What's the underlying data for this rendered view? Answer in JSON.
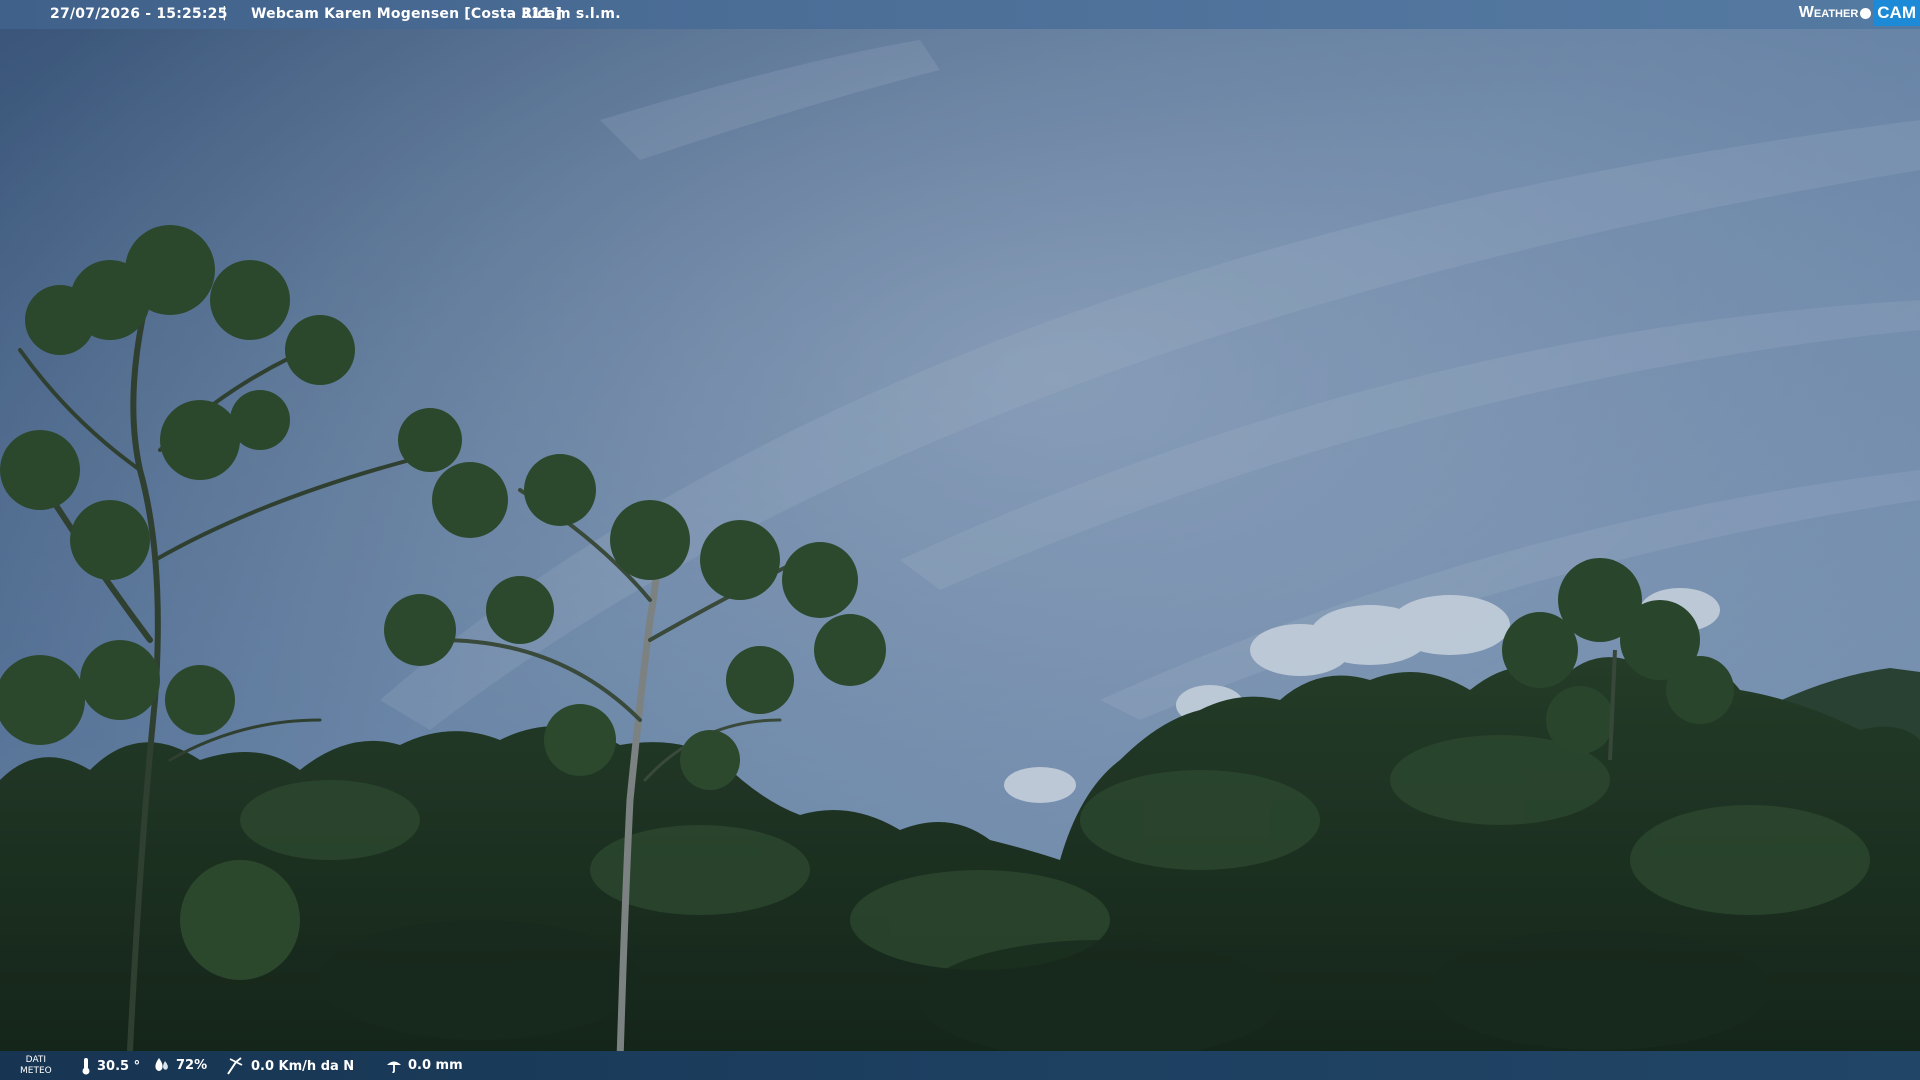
{
  "header": {
    "timestamp": "27/07/2026 - 15:25:25",
    "separator": "|",
    "title": "Webcam Karen Mogensen [Costa Rica]",
    "altitude": "- 311 m s.l.m."
  },
  "logo": {
    "weather": "Weather",
    "cam": "CAM",
    "icon": "globe-icon"
  },
  "footer": {
    "dati_line1": "DATI",
    "dati_line2": "METEO",
    "temperature": "30.5 °",
    "humidity": "72%",
    "wind": "0.0 Km/h da N",
    "rain": "0.0 mm",
    "icons": [
      "thermometer-icon",
      "humidity-drop-icon",
      "wind-icon",
      "rain-gauge-icon"
    ]
  },
  "colors": {
    "topbar": "#4b6e97",
    "bottombar": "#1d3f60",
    "logo_accent": "#1d8ad8",
    "sky": "#7f9bbd",
    "foliage": "#1f3a1e"
  }
}
